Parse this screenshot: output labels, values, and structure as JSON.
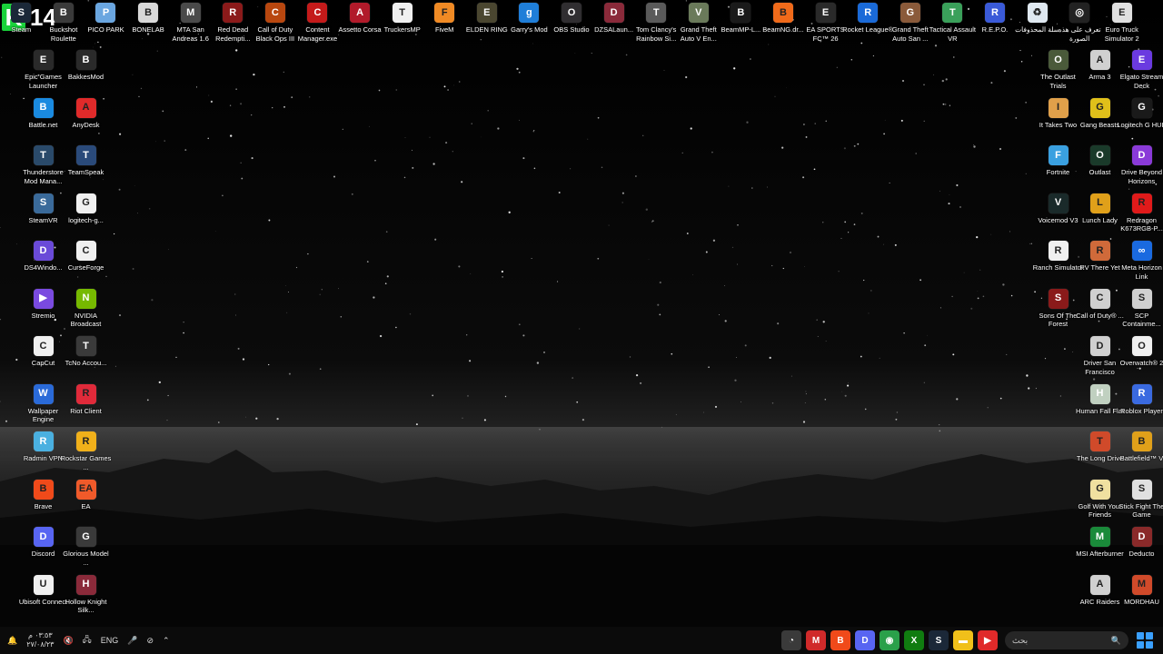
{
  "overlay": {
    "badge_letter": "K",
    "badge_number": "14"
  },
  "colors": {
    "desktop_bg": "#050505",
    "taskbar_bg": "#0c0c0c",
    "accent": "#3aa0ff"
  },
  "top_row": [
    {
      "label": "Steam",
      "icon": "steam-icon",
      "color": "#1b2838",
      "glyph": "S"
    },
    {
      "label": "Buckshot Roulette",
      "icon": "buckshot-icon",
      "color": "#3a3a3a",
      "glyph": "B"
    },
    {
      "label": "PICO PARK",
      "icon": "picopark-icon",
      "color": "#6aa6e0",
      "glyph": "P"
    },
    {
      "label": "BONELAB",
      "icon": "bonelab-icon",
      "color": "#d8d8d8",
      "glyph": "B"
    },
    {
      "label": "MTA San Andreas 1.6",
      "icon": "mta-icon",
      "color": "#4a4a4a",
      "glyph": "M"
    },
    {
      "label": "Red Dead Redempti...",
      "icon": "rdr-icon",
      "color": "#8b1a1a",
      "glyph": "R"
    },
    {
      "label": "Call of Duty Black Ops III",
      "icon": "cod-bo3-icon",
      "color": "#b8470f",
      "glyph": "C"
    },
    {
      "label": "Content Manager.exe",
      "icon": "content-manager-icon",
      "color": "#c41a1a",
      "glyph": "C"
    },
    {
      "label": "Assetto Corsa",
      "icon": "assetto-icon",
      "color": "#b11a2a",
      "glyph": "A"
    },
    {
      "label": "TruckersMP",
      "icon": "truckersmp-icon",
      "color": "#f0f0f0",
      "glyph": "T"
    },
    {
      "label": "FiveM",
      "icon": "fivem-icon",
      "color": "#f08a24",
      "glyph": "F"
    },
    {
      "label": "ELDEN RING",
      "icon": "eldenring-icon",
      "color": "#4a4630",
      "glyph": "E"
    },
    {
      "label": "Garry's Mod",
      "icon": "gmod-icon",
      "color": "#1f7ed8",
      "glyph": "g"
    },
    {
      "label": "OBS Studio",
      "icon": "obs-icon",
      "color": "#302e31",
      "glyph": "O"
    },
    {
      "label": "DZSALaun...",
      "icon": "dzsa-icon",
      "color": "#8a2a3a",
      "glyph": "D"
    },
    {
      "label": "Tom Clancy's Rainbow Si...",
      "icon": "r6-icon",
      "color": "#5a5a5a",
      "glyph": "T"
    },
    {
      "label": "Grand Theft Auto V En...",
      "icon": "gtav-icon",
      "color": "#6a7a5a",
      "glyph": "V"
    },
    {
      "label": "BeamMP-L...",
      "icon": "beammp-icon",
      "color": "#1a1a1a",
      "glyph": "B"
    },
    {
      "label": "BeamNG.dr...",
      "icon": "beamng-icon",
      "color": "#f06a1a",
      "glyph": "B"
    },
    {
      "label": "EA SPORTS FC™ 26",
      "icon": "easfc-icon",
      "color": "#2a2a2a",
      "glyph": "E"
    },
    {
      "label": "Rocket League®",
      "icon": "rocketleague-icon",
      "color": "#1a6ad8",
      "glyph": "R"
    },
    {
      "label": "Grand Theft Auto San ...",
      "icon": "gtasa-icon",
      "color": "#8a5a3a",
      "glyph": "G"
    },
    {
      "label": "Tactical Assault VR",
      "icon": "tacticalvr-icon",
      "color": "#3aa05a",
      "glyph": "T"
    },
    {
      "label": "R.E.P.O.",
      "icon": "repo-icon",
      "color": "#3a5ad8",
      "glyph": "R"
    },
    {
      "label": "سلة المحذوفات",
      "icon": "recycle-bin-icon",
      "color": "#dfe8f0",
      "glyph": "♻"
    },
    {
      "label": "تعرف على هذه الصورة",
      "icon": "learn-about-picture-icon",
      "color": "#222",
      "glyph": "◎"
    },
    {
      "label": "Euro Truck Simulator 2",
      "icon": "ets2-icon",
      "color": "#e0e0e0",
      "glyph": "E"
    }
  ],
  "left_col1": [
    {
      "label": "Epic Games Launcher",
      "icon": "epic-icon",
      "color": "#2a2a2a",
      "glyph": "E"
    },
    {
      "label": "Battle.net",
      "icon": "battlenet-icon",
      "color": "#1a8ae0",
      "glyph": "B"
    },
    {
      "label": "Thunderstore Mod Mana...",
      "icon": "thunderstore-icon",
      "color": "#2a4a6a",
      "glyph": "T"
    },
    {
      "label": "SteamVR",
      "icon": "steamvr-icon",
      "color": "#3a6a9a",
      "glyph": "S"
    },
    {
      "label": "DS4Windo...",
      "icon": "ds4-icon",
      "color": "#6a4ad8",
      "glyph": "D"
    },
    {
      "label": "Stremio",
      "icon": "stremio-icon",
      "color": "#7a4ae0",
      "glyph": "▶"
    },
    {
      "label": "CapCut",
      "icon": "capcut-icon",
      "color": "#f0f0f0",
      "glyph": "C"
    },
    {
      "label": "Wallpaper Engine",
      "icon": "wallpaper-engine-icon",
      "color": "#2a6ad8",
      "glyph": "W"
    },
    {
      "label": "Radmin VPN",
      "icon": "radmin-icon",
      "color": "#4ab0e0",
      "glyph": "R"
    },
    {
      "label": "Brave",
      "icon": "brave-icon",
      "color": "#f04a1a",
      "glyph": "B"
    },
    {
      "label": "Discord",
      "icon": "discord-icon",
      "color": "#5865f2",
      "glyph": "D"
    },
    {
      "label": "Ubisoft Connect",
      "icon": "ubisoft-icon",
      "color": "#f0f0f0",
      "glyph": "U"
    }
  ],
  "left_col2": [
    {
      "label": "BakkesMod",
      "icon": "bakkesmod-icon",
      "color": "#2a2a2a",
      "glyph": "B"
    },
    {
      "label": "AnyDesk",
      "icon": "anydesk-icon",
      "color": "#e02a2a",
      "glyph": "A"
    },
    {
      "label": "TeamSpeak",
      "icon": "teamspeak-icon",
      "color": "#2a4a7a",
      "glyph": "T"
    },
    {
      "label": "logitech-g...",
      "icon": "logitech-icon",
      "color": "#f0f0f0",
      "glyph": "G"
    },
    {
      "label": "CurseForge",
      "icon": "curseforge-icon",
      "color": "#f0f0f0",
      "glyph": "C"
    },
    {
      "label": "NVIDIA Broadcast",
      "icon": "nvidia-icon",
      "color": "#76b900",
      "glyph": "N"
    },
    {
      "label": "TcNo Accou...",
      "icon": "tcno-icon",
      "color": "#3a3a3a",
      "glyph": "T"
    },
    {
      "label": "Riot Client",
      "icon": "riot-icon",
      "color": "#e02a3a",
      "glyph": "R"
    },
    {
      "label": "Rockstar Games ...",
      "icon": "rockstar-icon",
      "color": "#f0b01a",
      "glyph": "R"
    },
    {
      "label": "EA",
      "icon": "ea-icon",
      "color": "#f05a2a",
      "glyph": "EA"
    },
    {
      "label": "Glorious Model ...",
      "icon": "glorious-icon",
      "color": "#3a3a3a",
      "glyph": "G"
    },
    {
      "label": "Hollow Knight Silk...",
      "icon": "hollowknight-icon",
      "color": "#8a2a3a",
      "glyph": "H"
    }
  ],
  "right_col1": [
    {
      "label": "The Outlast Trials",
      "icon": "outlast-trials-icon",
      "color": "#4a5a3a",
      "glyph": "O"
    },
    {
      "label": "It Takes Two",
      "icon": "ittakestwo-icon",
      "color": "#e0a04a",
      "glyph": "I"
    },
    {
      "label": "Fortnite",
      "icon": "fortnite-icon",
      "color": "#3aa0e0",
      "glyph": "F"
    },
    {
      "label": "Voicemod V3",
      "icon": "voicemod-icon",
      "color": "#1a2a2a",
      "glyph": "V"
    },
    {
      "label": "Ranch Simulator",
      "icon": "ranch-icon",
      "color": "#f0f0f0",
      "glyph": "R"
    },
    {
      "label": "Sons Of The Forest",
      "icon": "sotf-icon",
      "color": "#8a1a1a",
      "glyph": "S"
    },
    {
      "label": "",
      "icon": "",
      "color": "",
      "glyph": ""
    },
    {
      "label": "",
      "icon": "",
      "color": "",
      "glyph": ""
    },
    {
      "label": "",
      "icon": "",
      "color": "",
      "glyph": ""
    },
    {
      "label": "",
      "icon": "",
      "color": "",
      "glyph": ""
    },
    {
      "label": "",
      "icon": "",
      "color": "",
      "glyph": ""
    },
    {
      "label": "",
      "icon": "",
      "color": "",
      "glyph": ""
    }
  ],
  "right_col2": [
    {
      "label": "Arma 3",
      "icon": "arma3-icon",
      "color": "#d0d0d0",
      "glyph": "A"
    },
    {
      "label": "Gang Beasts",
      "icon": "gangbeasts-icon",
      "color": "#e0c01a",
      "glyph": "G"
    },
    {
      "label": "Outlast",
      "icon": "outlast-icon",
      "color": "#1a3a2a",
      "glyph": "O"
    },
    {
      "label": "Lunch Lady",
      "icon": "lunchlady-icon",
      "color": "#e0a01a",
      "glyph": "L"
    },
    {
      "label": "RV There Yet",
      "icon": "rvthereyet-icon",
      "color": "#d06a3a",
      "glyph": "R"
    },
    {
      "label": "Call of Duty® ...",
      "icon": "cod-icon",
      "color": "#d0d0d0",
      "glyph": "C"
    },
    {
      "label": "Driver San Francisco",
      "icon": "driversf-icon",
      "color": "#d0d0d0",
      "glyph": "D"
    },
    {
      "label": "Human Fall Flat",
      "icon": "humanfallflat-icon",
      "color": "#c0d0c0",
      "glyph": "H"
    },
    {
      "label": "The Long Drive",
      "icon": "longdrive-icon",
      "color": "#d04a2a",
      "glyph": "T"
    },
    {
      "label": "Golf With Your Friends",
      "icon": "golf-icon",
      "color": "#f0e0a0",
      "glyph": "G"
    },
    {
      "label": "MSI Afterburner",
      "icon": "msi-icon",
      "color": "#1a8a3a",
      "glyph": "M"
    },
    {
      "label": "ARC Raiders",
      "icon": "arcraiders-icon",
      "color": "#d0d0d0",
      "glyph": "A"
    }
  ],
  "right_col3": [
    {
      "label": "Elgato Stream Deck",
      "icon": "streamdeck-icon",
      "color": "#6a3ae0",
      "glyph": "E"
    },
    {
      "label": "Logitech G HUB",
      "icon": "ghub-icon",
      "color": "#1a1a1a",
      "glyph": "G"
    },
    {
      "label": "Drive Beyond Horizons",
      "icon": "drivebeyond-icon",
      "color": "#8a3ad8",
      "glyph": "D"
    },
    {
      "label": "Redragon K673RGB-P...",
      "icon": "redragon-icon",
      "color": "#e01a1a",
      "glyph": "R"
    },
    {
      "label": "Meta Horizon Link",
      "icon": "metalink-icon",
      "color": "#1a6ae0",
      "glyph": "∞"
    },
    {
      "label": "SCP Containme...",
      "icon": "scp-icon",
      "color": "#d0d0d0",
      "glyph": "S"
    },
    {
      "label": "Overwatch® 2",
      "icon": "overwatch-icon",
      "color": "#f0f0f0",
      "glyph": "O"
    },
    {
      "label": "Roblox Player",
      "icon": "roblox-icon",
      "color": "#3a6ae0",
      "glyph": "R"
    },
    {
      "label": "Battlefield™ V",
      "icon": "battlefield-icon",
      "color": "#e0a01a",
      "glyph": "B"
    },
    {
      "label": "Stick Fight The Game",
      "icon": "stickfight-icon",
      "color": "#e0e0e0",
      "glyph": "S"
    },
    {
      "label": "Deducto",
      "icon": "deducto-icon",
      "color": "#8a2a2a",
      "glyph": "D"
    },
    {
      "label": "MORDHAU",
      "icon": "mordhau-icon",
      "color": "#d04a2a",
      "glyph": "M"
    }
  ],
  "taskbar": {
    "clock_time": "٠٣:٥٣ م",
    "clock_date": "٢٧/٠٨/٢٣",
    "language": "ENG",
    "search_placeholder": "بحث",
    "apps": [
      {
        "name": "chrome-dev-icon",
        "color": "#3a3a3a",
        "glyph": "◔"
      },
      {
        "name": "mega-icon",
        "color": "#d02a2a",
        "glyph": "M"
      },
      {
        "name": "brave-taskbar-icon",
        "color": "#f04a1a",
        "glyph": "B"
      },
      {
        "name": "discord-taskbar-icon",
        "color": "#5865f2",
        "glyph": "D"
      },
      {
        "name": "chrome-icon",
        "color": "#2aa04a",
        "glyph": "◉"
      },
      {
        "name": "xbox-icon",
        "color": "#107c10",
        "glyph": "X"
      },
      {
        "name": "steam-taskbar-icon",
        "color": "#1b2838",
        "glyph": "S"
      },
      {
        "name": "file-explorer-icon",
        "color": "#f0c01a",
        "glyph": "▬"
      },
      {
        "name": "youtube-icon",
        "color": "#e02a2a",
        "glyph": "▶"
      }
    ]
  }
}
